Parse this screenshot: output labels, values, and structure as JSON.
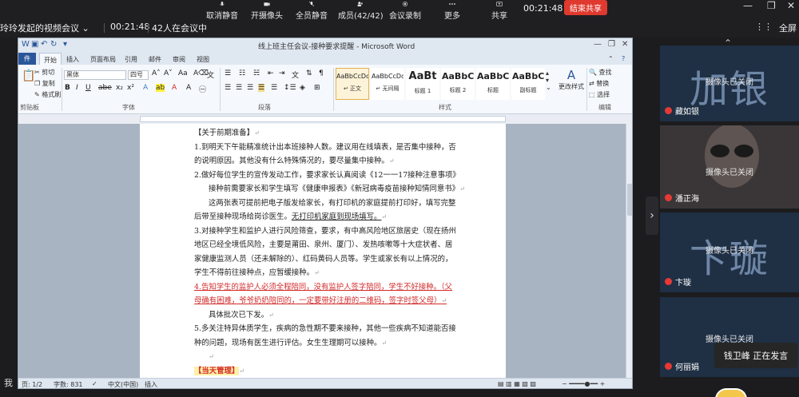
{
  "toolbar": {
    "items": [
      {
        "label": "取消静音",
        "icon": "mic-icon"
      },
      {
        "label": "开摄像头",
        "icon": "camera-icon"
      },
      {
        "label": "全员静音",
        "icon": "mute-all-icon"
      },
      {
        "label": "成员(42/42)",
        "icon": "members-icon"
      },
      {
        "label": "会议录制",
        "icon": "record-icon"
      },
      {
        "label": "更多",
        "icon": "more-icon"
      },
      {
        "label": "共享",
        "icon": "share-icon"
      }
    ],
    "time": "00:21:48",
    "end_share": "结束共享"
  },
  "meeting": {
    "title": "玲玲发起的视频会议",
    "duration": "00:21:48",
    "count_text": "42人在会议中",
    "exit_fullscreen": "全屏"
  },
  "word": {
    "title": "线上班主任会议-接种要求提醒 - Microsoft Word",
    "tabs": [
      "开始",
      "插入",
      "页面布局",
      "引用",
      "邮件",
      "审阅",
      "视图"
    ],
    "file_tab": "件",
    "clipboard": {
      "cut": "剪切",
      "copy": "复制",
      "paste_format": "格式刷",
      "group": "剪贴板"
    },
    "font": {
      "name": "黑体",
      "size": "四号",
      "group": "字体"
    },
    "paragraph_group": "段落",
    "styles": [
      {
        "preview": "AaBbCcDd",
        "name": "↵ 正文"
      },
      {
        "preview": "AaBbCcDd",
        "name": "↵ 无间隔"
      },
      {
        "preview": "AaBt",
        "name": "标题 1"
      },
      {
        "preview": "AaBbC",
        "name": "标题 2"
      },
      {
        "preview": "AaBbC",
        "name": "标题"
      },
      {
        "preview": "AaBbC",
        "name": "副标题"
      }
    ],
    "styles_group": "样式",
    "change_styles": "更改样式",
    "editing": {
      "find": "查找",
      "replace": "替换",
      "select": "选择",
      "group": "编辑"
    },
    "lines": [
      "【关于前期准备】",
      "1.到明天下午能精准统计出本班接种人数。建议用在线填表，是否集中接种，否",
      "的说明原因。其他没有什么特殊情况的，要尽量集中接种。",
      "2.做好每位学生的宣传发动工作，要求家长认真阅读《12一一17接种注意事项》",
      "接种前需要家长和学生填写《健康申报表》《新冠病毒疫苗接种知情同意书》",
      "这两张表可提前把电子版发给家长，有打印机的家庭提前打印好，填写完整",
      "后带至接种现场给岗诊医生。",
      "无打印机家庭到现场填写。",
      "3.对接种学生和监护人进行风险筛查，要求，有中高风险地区旅居史（现在扬州",
      "地区已经全境低风险，主要是莆田、泉州、厦门）、发热咳嗽等十大症状者、居",
      "家健康监测人员（还未解除的）、红码黄码人员等。学生或家长有以上情况的，",
      "学生不得前往接种点，应暂缓接种。",
      "4.告知学生的监护人必须全程陪同，没有监护人签字陪同，学生不好接种。（父",
      "母确有困难，爷爷奶奶陪同的，一定要带好注册的二维码，签字时签父母）",
      "具体批次已下发。",
      "5.多关注特异体质学生，疾病的急性期不要来接种，其他一些疾病不知道能否接",
      "种的问题，现场有医生进行评估。女生生理期可以接种。",
      "【当天管理】"
    ],
    "status": {
      "page": "页: 1/2",
      "words": "字数: 831",
      "lang": "中文(中国)",
      "mode": "插入"
    }
  },
  "participants": [
    {
      "name": "藏如银",
      "big": "加银",
      "status": "摄像头已关闭"
    },
    {
      "name": "潘正海",
      "big": "",
      "status": "摄像头已关闭"
    },
    {
      "name": "卞璇",
      "big": "卞璇",
      "status": "摄像头已关闭"
    },
    {
      "name": "何丽娟",
      "big": "",
      "status": "摄像头已关闭"
    }
  ],
  "speaking": "钱卫峰  正在发言",
  "left_char": "我"
}
